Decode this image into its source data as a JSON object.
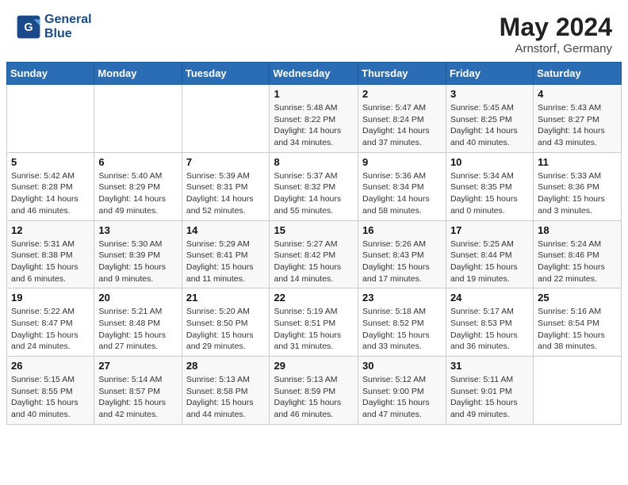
{
  "header": {
    "logo_line1": "General",
    "logo_line2": "Blue",
    "month": "May 2024",
    "location": "Arnstorf, Germany"
  },
  "weekdays": [
    "Sunday",
    "Monday",
    "Tuesday",
    "Wednesday",
    "Thursday",
    "Friday",
    "Saturday"
  ],
  "weeks": [
    [
      {
        "day": "",
        "info": ""
      },
      {
        "day": "",
        "info": ""
      },
      {
        "day": "",
        "info": ""
      },
      {
        "day": "1",
        "info": "Sunrise: 5:48 AM\nSunset: 8:22 PM\nDaylight: 14 hours and 34 minutes."
      },
      {
        "day": "2",
        "info": "Sunrise: 5:47 AM\nSunset: 8:24 PM\nDaylight: 14 hours and 37 minutes."
      },
      {
        "day": "3",
        "info": "Sunrise: 5:45 AM\nSunset: 8:25 PM\nDaylight: 14 hours and 40 minutes."
      },
      {
        "day": "4",
        "info": "Sunrise: 5:43 AM\nSunset: 8:27 PM\nDaylight: 14 hours and 43 minutes."
      }
    ],
    [
      {
        "day": "5",
        "info": "Sunrise: 5:42 AM\nSunset: 8:28 PM\nDaylight: 14 hours and 46 minutes."
      },
      {
        "day": "6",
        "info": "Sunrise: 5:40 AM\nSunset: 8:29 PM\nDaylight: 14 hours and 49 minutes."
      },
      {
        "day": "7",
        "info": "Sunrise: 5:39 AM\nSunset: 8:31 PM\nDaylight: 14 hours and 52 minutes."
      },
      {
        "day": "8",
        "info": "Sunrise: 5:37 AM\nSunset: 8:32 PM\nDaylight: 14 hours and 55 minutes."
      },
      {
        "day": "9",
        "info": "Sunrise: 5:36 AM\nSunset: 8:34 PM\nDaylight: 14 hours and 58 minutes."
      },
      {
        "day": "10",
        "info": "Sunrise: 5:34 AM\nSunset: 8:35 PM\nDaylight: 15 hours and 0 minutes."
      },
      {
        "day": "11",
        "info": "Sunrise: 5:33 AM\nSunset: 8:36 PM\nDaylight: 15 hours and 3 minutes."
      }
    ],
    [
      {
        "day": "12",
        "info": "Sunrise: 5:31 AM\nSunset: 8:38 PM\nDaylight: 15 hours and 6 minutes."
      },
      {
        "day": "13",
        "info": "Sunrise: 5:30 AM\nSunset: 8:39 PM\nDaylight: 15 hours and 9 minutes."
      },
      {
        "day": "14",
        "info": "Sunrise: 5:29 AM\nSunset: 8:41 PM\nDaylight: 15 hours and 11 minutes."
      },
      {
        "day": "15",
        "info": "Sunrise: 5:27 AM\nSunset: 8:42 PM\nDaylight: 15 hours and 14 minutes."
      },
      {
        "day": "16",
        "info": "Sunrise: 5:26 AM\nSunset: 8:43 PM\nDaylight: 15 hours and 17 minutes."
      },
      {
        "day": "17",
        "info": "Sunrise: 5:25 AM\nSunset: 8:44 PM\nDaylight: 15 hours and 19 minutes."
      },
      {
        "day": "18",
        "info": "Sunrise: 5:24 AM\nSunset: 8:46 PM\nDaylight: 15 hours and 22 minutes."
      }
    ],
    [
      {
        "day": "19",
        "info": "Sunrise: 5:22 AM\nSunset: 8:47 PM\nDaylight: 15 hours and 24 minutes."
      },
      {
        "day": "20",
        "info": "Sunrise: 5:21 AM\nSunset: 8:48 PM\nDaylight: 15 hours and 27 minutes."
      },
      {
        "day": "21",
        "info": "Sunrise: 5:20 AM\nSunset: 8:50 PM\nDaylight: 15 hours and 29 minutes."
      },
      {
        "day": "22",
        "info": "Sunrise: 5:19 AM\nSunset: 8:51 PM\nDaylight: 15 hours and 31 minutes."
      },
      {
        "day": "23",
        "info": "Sunrise: 5:18 AM\nSunset: 8:52 PM\nDaylight: 15 hours and 33 minutes."
      },
      {
        "day": "24",
        "info": "Sunrise: 5:17 AM\nSunset: 8:53 PM\nDaylight: 15 hours and 36 minutes."
      },
      {
        "day": "25",
        "info": "Sunrise: 5:16 AM\nSunset: 8:54 PM\nDaylight: 15 hours and 38 minutes."
      }
    ],
    [
      {
        "day": "26",
        "info": "Sunrise: 5:15 AM\nSunset: 8:55 PM\nDaylight: 15 hours and 40 minutes."
      },
      {
        "day": "27",
        "info": "Sunrise: 5:14 AM\nSunset: 8:57 PM\nDaylight: 15 hours and 42 minutes."
      },
      {
        "day": "28",
        "info": "Sunrise: 5:13 AM\nSunset: 8:58 PM\nDaylight: 15 hours and 44 minutes."
      },
      {
        "day": "29",
        "info": "Sunrise: 5:13 AM\nSunset: 8:59 PM\nDaylight: 15 hours and 46 minutes."
      },
      {
        "day": "30",
        "info": "Sunrise: 5:12 AM\nSunset: 9:00 PM\nDaylight: 15 hours and 47 minutes."
      },
      {
        "day": "31",
        "info": "Sunrise: 5:11 AM\nSunset: 9:01 PM\nDaylight: 15 hours and 49 minutes."
      },
      {
        "day": "",
        "info": ""
      }
    ]
  ]
}
